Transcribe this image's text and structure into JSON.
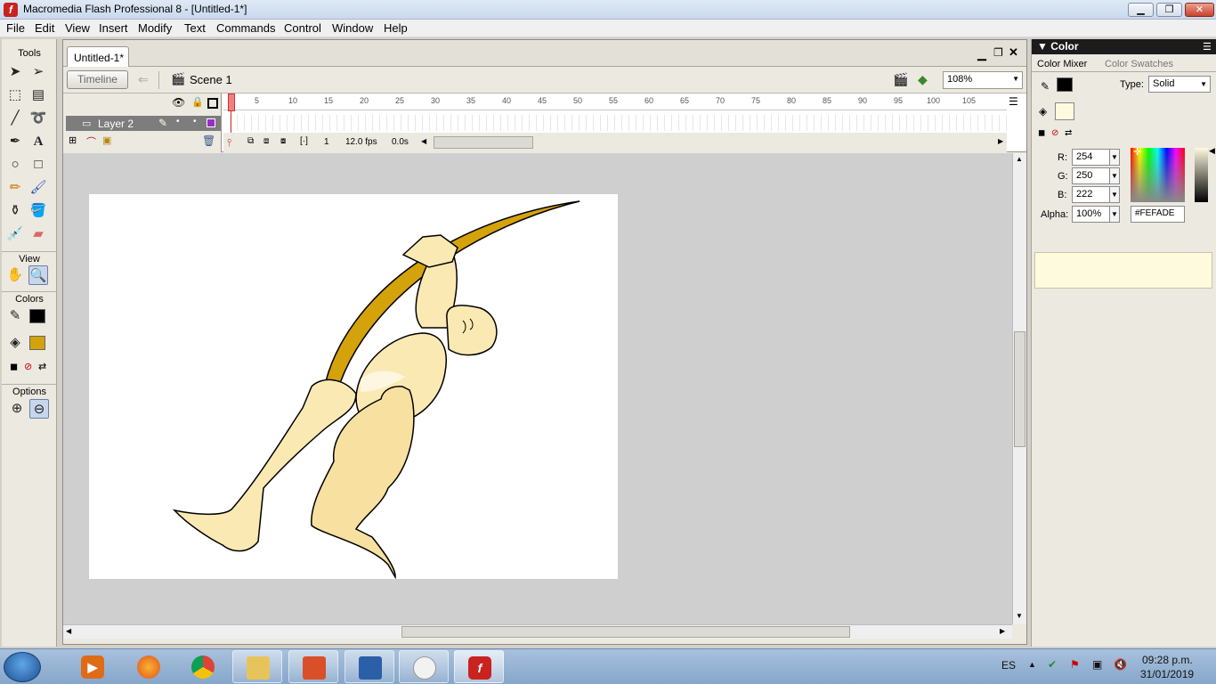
{
  "window": {
    "title": "Macromedia Flash Professional 8 - [Untitled-1*]",
    "app_icon": "f"
  },
  "menu": [
    "File",
    "Edit",
    "View",
    "Insert",
    "Modify",
    "Text",
    "Commands",
    "Control",
    "Window",
    "Help"
  ],
  "tools": {
    "title": "Tools",
    "view_label": "View",
    "colors_label": "Colors",
    "options_label": "Options"
  },
  "document": {
    "tab": "Untitled-1*",
    "timeline_btn": "Timeline",
    "scene": "Scene 1",
    "zoom": "108%",
    "layer": "Layer 2",
    "ruler": [
      "1",
      "5",
      "10",
      "15",
      "20",
      "25",
      "30",
      "35",
      "40",
      "45",
      "50",
      "55",
      "60",
      "65",
      "70",
      "75",
      "80",
      "85",
      "90",
      "95",
      "100",
      "105"
    ],
    "current_frame": "1",
    "fps": "12.0 fps",
    "elapsed": "0.0s"
  },
  "color_panel": {
    "title": "Color",
    "tab_mixer": "Color Mixer",
    "tab_swatches": "Color Swatches",
    "type_label": "Type:",
    "type_value": "Solid",
    "r_label": "R:",
    "r": "254",
    "g_label": "G:",
    "g": "250",
    "b_label": "B:",
    "b": "222",
    "alpha_label": "Alpha:",
    "alpha": "100%",
    "hex": "#FEFADE",
    "stroke_color": "#000000",
    "fill_color": "#fefade"
  },
  "colors": {
    "bow": "#d4a20a",
    "skin": "#fbe9b4",
    "skin_shade": "#f5dc98",
    "tool_fill": "#d4a20a"
  },
  "taskbar": {
    "lang": "ES",
    "time": "09:28 p.m.",
    "date": "31/01/2019"
  }
}
